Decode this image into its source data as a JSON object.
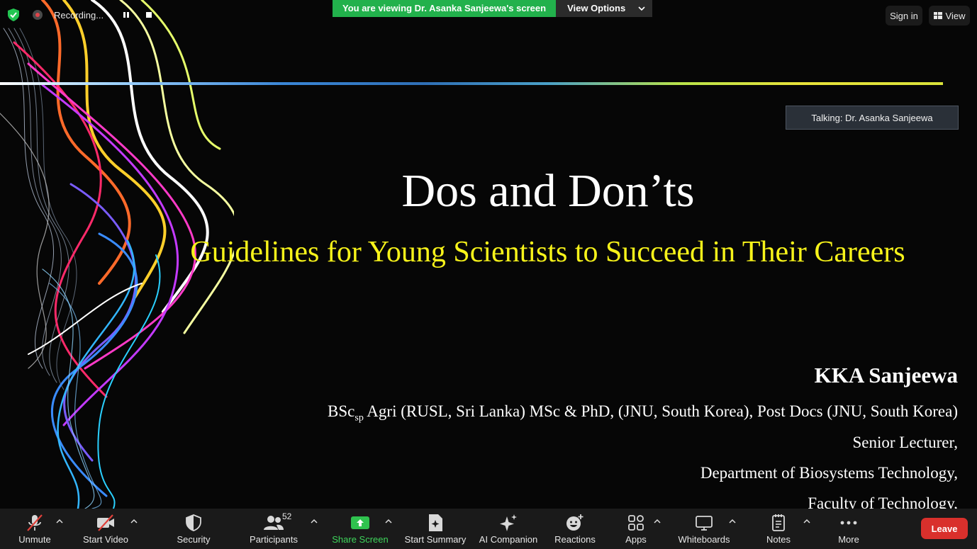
{
  "recording": {
    "label": "Recording..."
  },
  "banner": {
    "viewing_text": "You are viewing Dr. Asanka Sanjeewa's screen",
    "view_options_label": "View Options"
  },
  "top_right": {
    "sign_in_label": "Sign in",
    "view_label": "View"
  },
  "talking": {
    "text": "Talking: Dr. Asanka Sanjeewa"
  },
  "slide": {
    "title": "Dos and Don’ts",
    "subtitle": "Guidelines for Young Scientists to Succeed in Their Careers",
    "author": "KKA Sanjeewa",
    "degree_prefix": "BSc",
    "degree_sub": "sp",
    "degree_rest": " Agri (RUSL, Sri Lanka) MSc & PhD, (JNU, South Korea), Post Docs (JNU, South Korea)",
    "position": "Senior Lecturer,",
    "department": "Department of Biosystems Technology,",
    "faculty": "Faculty of Technology,"
  },
  "toolbar": {
    "unmute_label": "Unmute",
    "start_video_label": "Start Video",
    "security_label": "Security",
    "participants_label": "Participants",
    "participants_count": "52",
    "share_screen_label": "Share Screen",
    "start_summary_label": "Start Summary",
    "ai_companion_label": "AI Companion",
    "reactions_label": "Reactions",
    "apps_label": "Apps",
    "whiteboards_label": "Whiteboards",
    "notes_label": "Notes",
    "more_label": "More",
    "leave_label": "Leave"
  },
  "colors": {
    "banner_green": "#22b14c",
    "share_green": "#3ed45b",
    "leave_red": "#d9302c",
    "subtitle_yellow": "#f7f31a",
    "shield_green": "#23c552"
  }
}
